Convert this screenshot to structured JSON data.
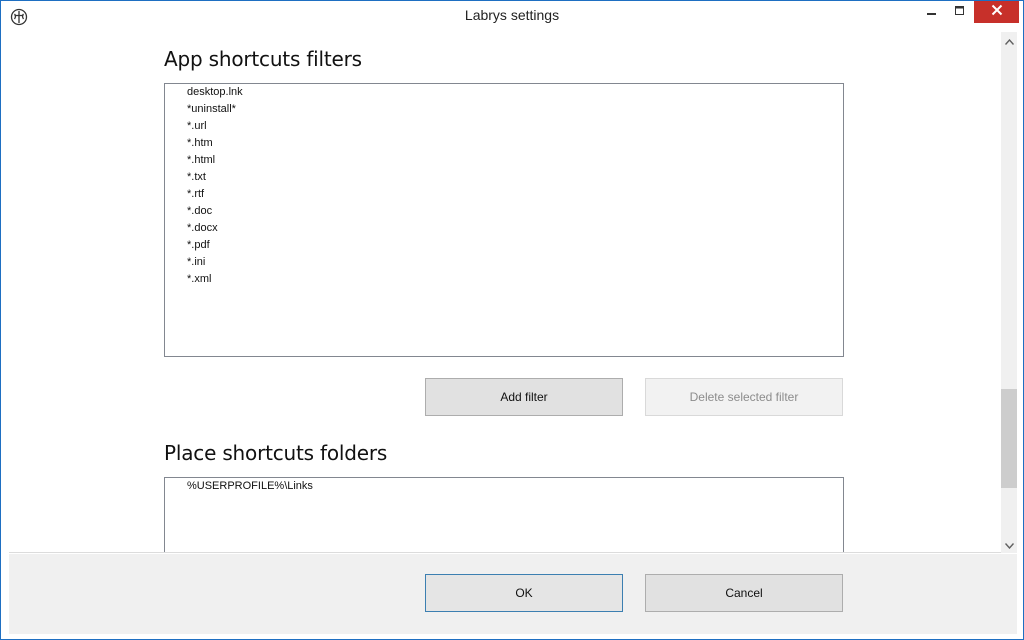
{
  "window": {
    "title": "Labrys settings",
    "icons": {
      "app": "labrys-app-icon",
      "minimize": "minimize-icon",
      "maximize": "maximize-icon",
      "close": "close-icon"
    }
  },
  "sections": {
    "app_filters": {
      "heading": "App shortcuts filters",
      "items": [
        "desktop.lnk",
        "*uninstall*",
        "*.url",
        "*.htm",
        "*.html",
        "*.txt",
        "*.rtf",
        "*.doc",
        "*.docx",
        "*.pdf",
        "*.ini",
        "*.xml"
      ],
      "add_button": "Add filter",
      "delete_button": "Delete selected filter"
    },
    "place_folders": {
      "heading": "Place shortcuts folders",
      "items": [
        "%USERPROFILE%\\Links"
      ]
    }
  },
  "footer": {
    "ok": "OK",
    "cancel": "Cancel"
  },
  "colors": {
    "close_button": "#c7302a",
    "window_border": "#1e6fc2",
    "ok_border": "#3c7fb1"
  }
}
